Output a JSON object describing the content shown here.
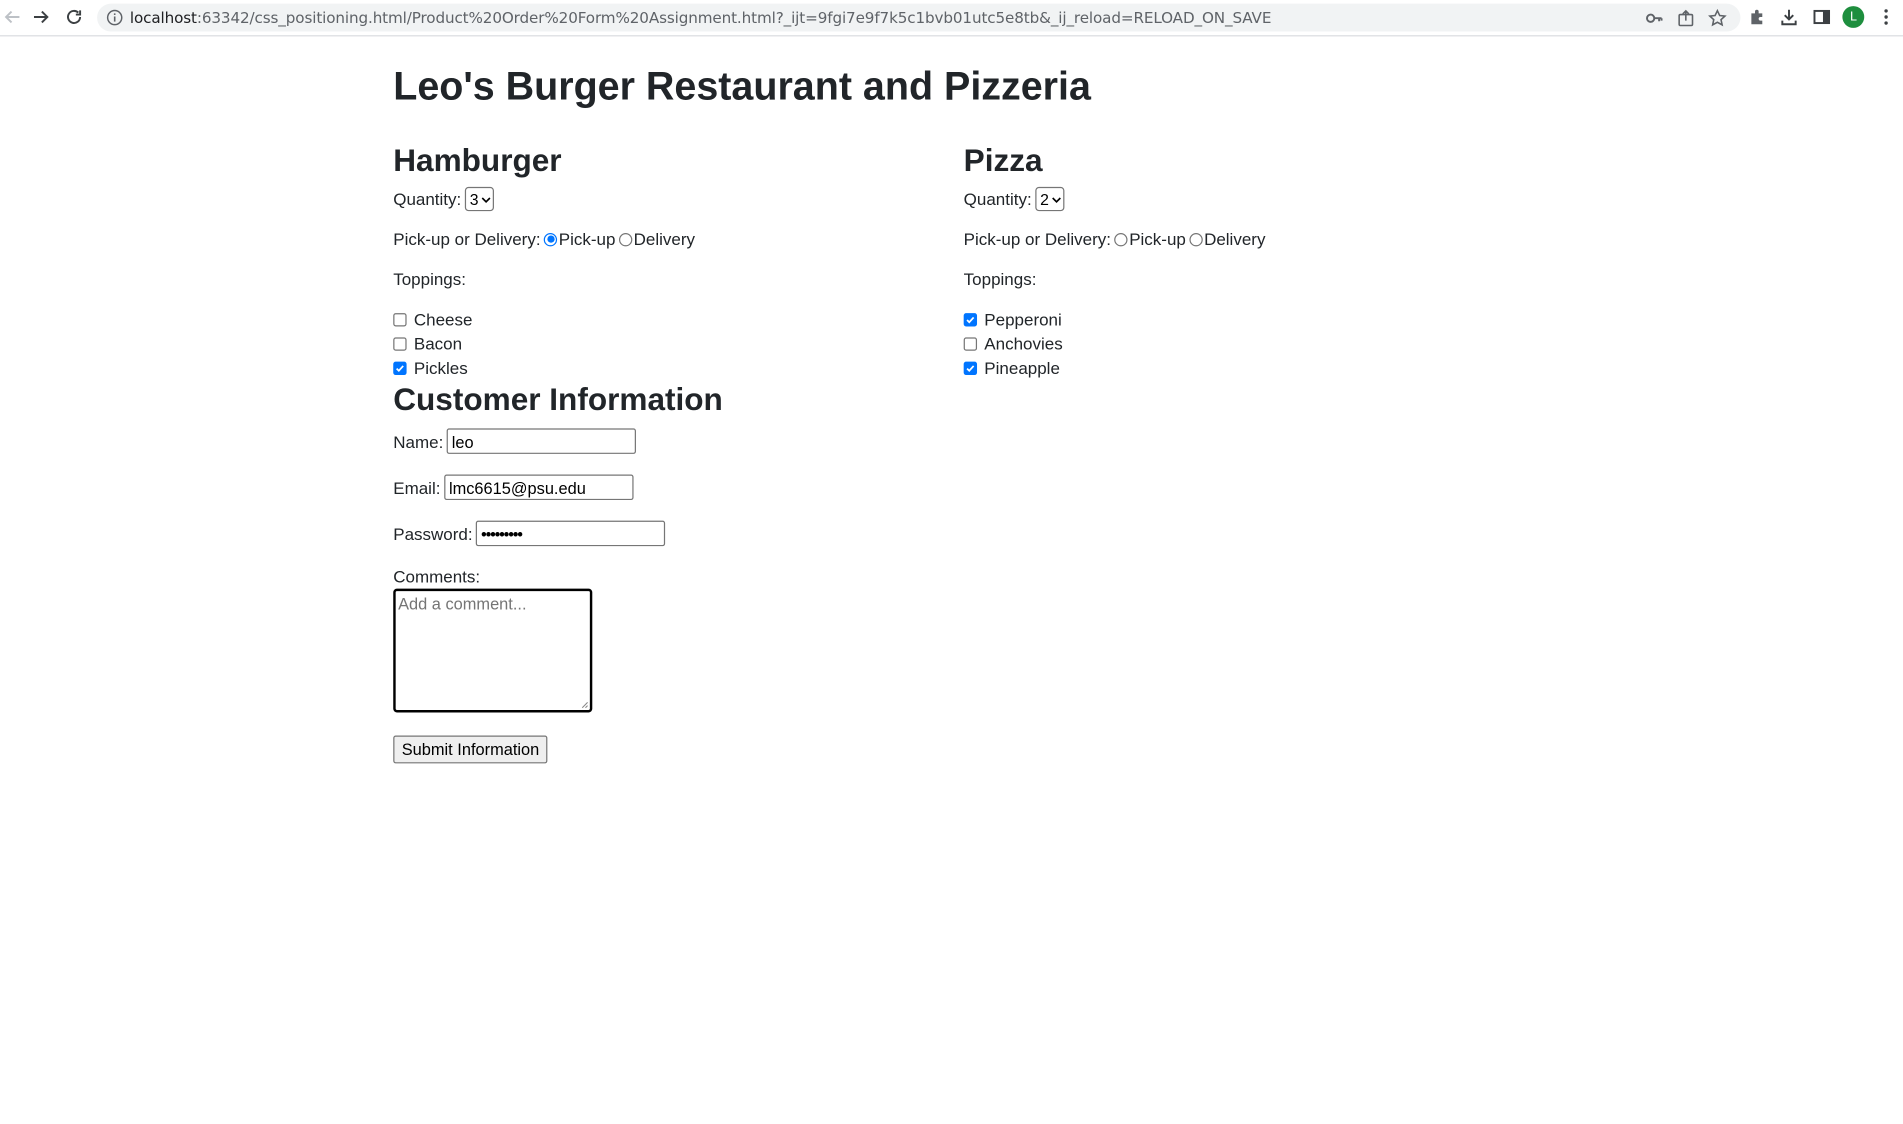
{
  "browser": {
    "url_host": "localhost",
    "url_rest": ":63342/css_positioning.html/Product%20Order%20Form%20Assignment.html?_ijt=9fgi7e9f7k5c1bvb01utc5e8tb&_ij_reload=RELOAD_ON_SAVE",
    "profile_initial": "L",
    "icons": [
      "back-icon",
      "forward-icon",
      "reload-icon",
      "info-icon",
      "key-icon",
      "share-icon",
      "star-icon",
      "extensions-icon",
      "download-icon",
      "side-panel-icon",
      "menu-icon"
    ]
  },
  "page": {
    "title": "Leo's Burger Restaurant and Pizzeria",
    "hamburger": {
      "heading": "Hamburger",
      "quantity_label": "Quantity:",
      "quantity_value": "3",
      "pickup_label": "Pick-up or Delivery:",
      "pickup_option": "Pick-up",
      "delivery_option": "Delivery",
      "selected": "Pick-up",
      "toppings_label": "Toppings:",
      "toppings": [
        {
          "label": "Cheese",
          "checked": false
        },
        {
          "label": "Bacon",
          "checked": false
        },
        {
          "label": "Pickles",
          "checked": true
        }
      ]
    },
    "pizza": {
      "heading": "Pizza",
      "quantity_label": "Quantity:",
      "quantity_value": "2",
      "pickup_label": "Pick-up or Delivery:",
      "pickup_option": "Pick-up",
      "delivery_option": "Delivery",
      "selected": "",
      "toppings_label": "Toppings:",
      "toppings": [
        {
          "label": "Pepperoni",
          "checked": true
        },
        {
          "label": "Anchovies",
          "checked": false
        },
        {
          "label": "Pineapple",
          "checked": true
        }
      ]
    },
    "customer": {
      "heading": "Customer Information",
      "name_label": "Name:",
      "name_value": "leo",
      "email_label": "Email:",
      "email_value": "lmc6615@psu.edu",
      "password_label": "Password:",
      "password_value": "•••••••••",
      "comments_label": "Comments:",
      "comments_placeholder": "Add a comment...",
      "submit_label": "Submit Information"
    }
  },
  "colors": {
    "accent": "#0075ff",
    "text": "#212529",
    "avatar": "#1e8e3e"
  }
}
